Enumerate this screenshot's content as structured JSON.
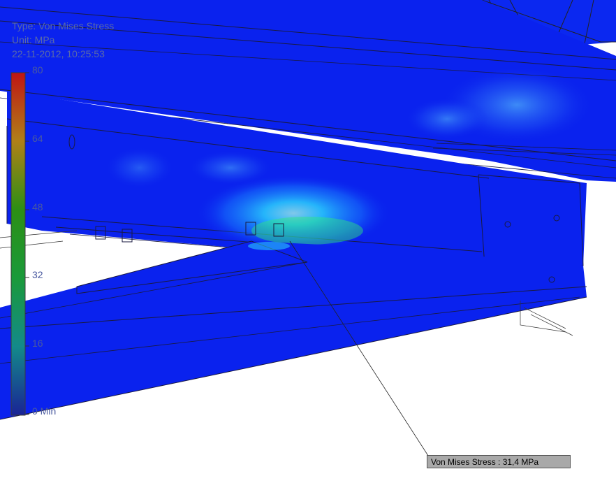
{
  "result": {
    "type_line": "Type: Von Mises Stress",
    "unit_line": "Unit: MPa",
    "timestamp": "22-11-2012, 10:25:53"
  },
  "legend": {
    "ticks": [
      "80",
      "64",
      "48",
      "32",
      "16",
      "0 Min"
    ],
    "colors": [
      "#b22222",
      "#a8761a",
      "#2f8f1a",
      "#1a8a3a",
      "#137a8a",
      "#1a2a8a"
    ]
  },
  "probe": {
    "label": "Von Mises Stress : 31,4 MPa"
  },
  "colors": {
    "model_blue": "#0a22ee",
    "stress_cyan": "#19e3ff",
    "stress_green": "#27c24a"
  }
}
